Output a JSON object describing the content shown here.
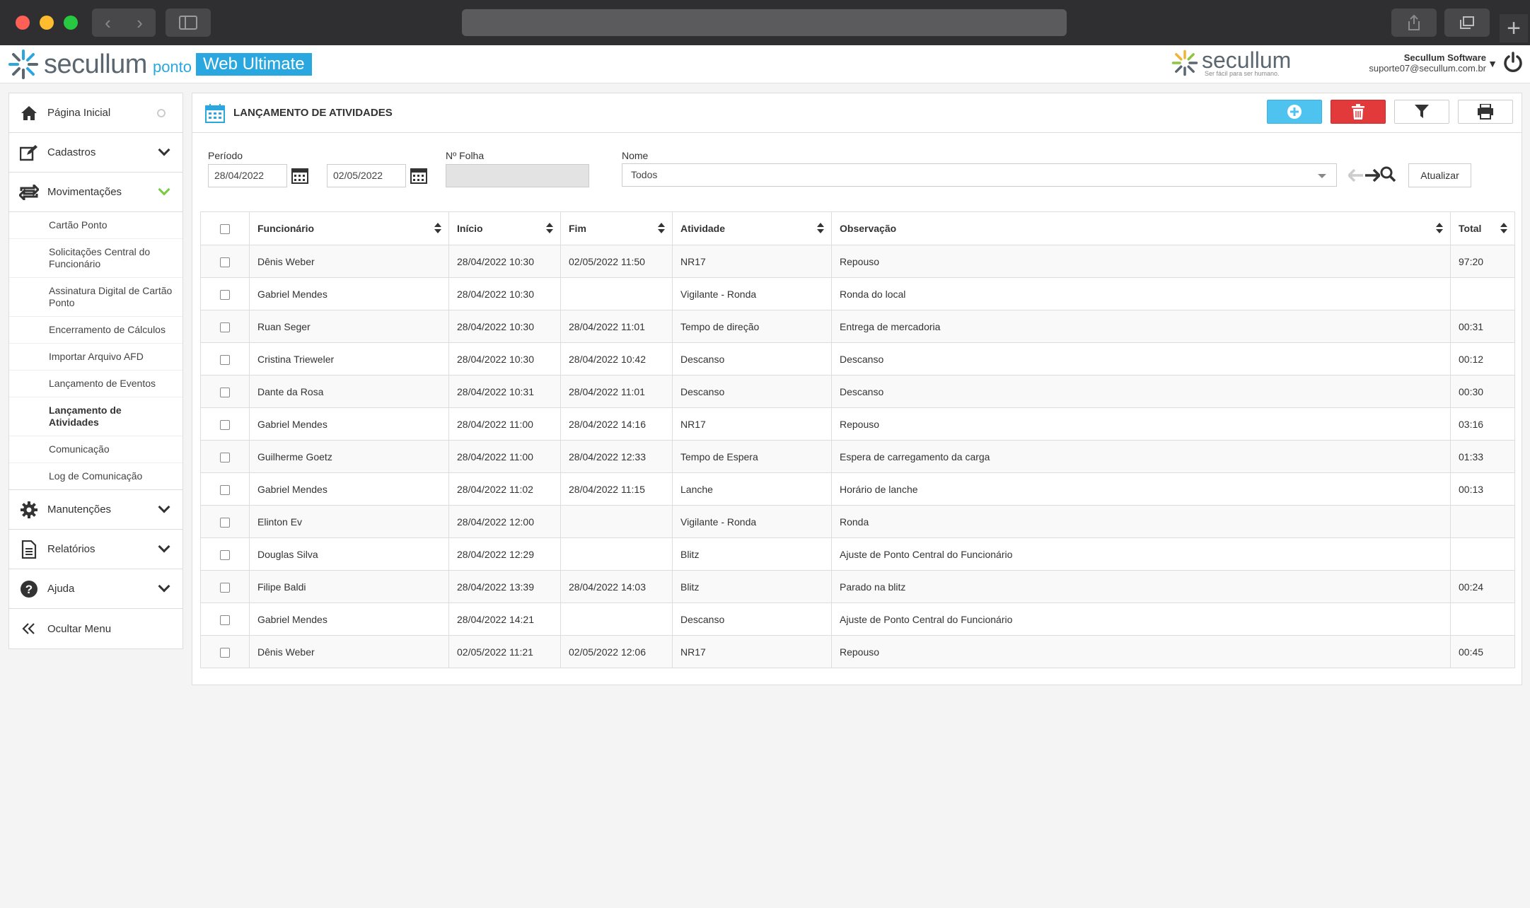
{
  "app": {
    "logo_text": "secullum",
    "logo_ponto": "ponto",
    "logo_badge": "Web Ultimate",
    "brand_right_name": "secullum",
    "brand_right_tagline": "Ser fácil para ser humano.",
    "user_company": "Secullum Software",
    "user_email": "suporte07@secullum.com.br",
    "brand_color": "#2aa7df"
  },
  "sidebar": {
    "items": [
      {
        "label": "Página Inicial",
        "icon": "home-icon"
      },
      {
        "label": "Cadastros",
        "icon": "edit-icon"
      },
      {
        "label": "Movimentações",
        "icon": "swap-icon"
      },
      {
        "label": "Manutenções",
        "icon": "gear-icon"
      },
      {
        "label": "Relatórios",
        "icon": "document-icon"
      },
      {
        "label": "Ajuda",
        "icon": "help-icon"
      },
      {
        "label": "Ocultar Menu",
        "icon": "double-chevron-left-icon"
      }
    ],
    "submenu": [
      "Cartão Ponto",
      "Solicitações Central do Funcionário",
      "Assinatura Digital de Cartão Ponto",
      "Encerramento de Cálculos",
      "Importar Arquivo AFD",
      "Lançamento de Eventos",
      "Lançamento de Atividades",
      "Comunicação",
      "Log de Comunicação"
    ],
    "active_submenu": "Lançamento de Atividades"
  },
  "page": {
    "title": "LANÇAMENTO DE ATIVIDADES",
    "toolbar": {
      "add_color": "#4fc3ef",
      "delete_color": "#e2393a"
    }
  },
  "filters": {
    "periodo_label": "Período",
    "date_start": "28/04/2022",
    "date_end": "02/05/2022",
    "folha_label": "Nº Folha",
    "folha_value": "",
    "nome_label": "Nome",
    "nome_value": "Todos",
    "atualizar_label": "Atualizar"
  },
  "table": {
    "columns": [
      "Funcionário",
      "Início",
      "Fim",
      "Atividade",
      "Observação",
      "Total"
    ],
    "rows": [
      [
        "Dênis Weber",
        "28/04/2022 10:30",
        "02/05/2022 11:50",
        "NR17",
        "Repouso",
        "97:20"
      ],
      [
        "Gabriel Mendes",
        "28/04/2022 10:30",
        "",
        "Vigilante - Ronda",
        "Ronda do local",
        ""
      ],
      [
        "Ruan Seger",
        "28/04/2022 10:30",
        "28/04/2022 11:01",
        "Tempo de direção",
        "Entrega de mercadoria",
        "00:31"
      ],
      [
        "Cristina Trieweler",
        "28/04/2022 10:30",
        "28/04/2022 10:42",
        "Descanso",
        "Descanso",
        "00:12"
      ],
      [
        "Dante da Rosa",
        "28/04/2022 10:31",
        "28/04/2022 11:01",
        "Descanso",
        "Descanso",
        "00:30"
      ],
      [
        "Gabriel Mendes",
        "28/04/2022 11:00",
        "28/04/2022 14:16",
        "NR17",
        "Repouso",
        "03:16"
      ],
      [
        "Guilherme Goetz",
        "28/04/2022 11:00",
        "28/04/2022 12:33",
        "Tempo de Espera",
        "Espera de carregamento da carga",
        "01:33"
      ],
      [
        "Gabriel Mendes",
        "28/04/2022 11:02",
        "28/04/2022 11:15",
        "Lanche",
        "Horário de lanche",
        "00:13"
      ],
      [
        "Elinton Ev",
        "28/04/2022 12:00",
        "",
        "Vigilante - Ronda",
        "Ronda",
        ""
      ],
      [
        "Douglas Silva",
        "28/04/2022 12:29",
        "",
        "Blitz",
        "Ajuste de Ponto Central do Funcionário",
        ""
      ],
      [
        "Filipe Baldi",
        "28/04/2022 13:39",
        "28/04/2022 14:03",
        "Blitz",
        "Parado na blitz",
        "00:24"
      ],
      [
        "Gabriel Mendes",
        "28/04/2022 14:21",
        "",
        "Descanso",
        "Ajuste de Ponto Central do Funcionário",
        ""
      ],
      [
        "Dênis Weber",
        "02/05/2022 11:21",
        "02/05/2022 12:06",
        "NR17",
        "Repouso",
        "00:45"
      ]
    ]
  }
}
